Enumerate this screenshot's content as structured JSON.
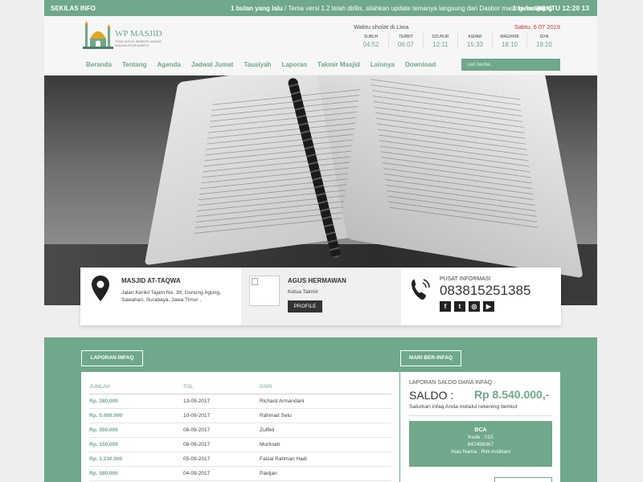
{
  "topbar": {
    "label": "SEKILAS INFO",
    "ticker_ago": "1 bulan yang lalu",
    "ticker_text": " / Tema versi 1.2 telah dirilis, silahkan update temanya langsung dari Dasbor masing-masing",
    "ticker_ago_2": "1 bulan yang",
    "waktu": "WAKTU 12:20 13"
  },
  "logo": {
    "name": "WP MASJID",
    "tagline": "TEMA UNTUK WEBSITE MASJID",
    "tagline2": "DENGAN FITUR KOMPLIT"
  },
  "sholat": {
    "title": "Waktu sholat di Liwa",
    "date": "Sabtu, 6 07 2019",
    "times": [
      {
        "name": "SUBUH",
        "time": "04:52"
      },
      {
        "name": "TERBIT",
        "time": "06:07"
      },
      {
        "name": "DZUHUR",
        "time": "12:11"
      },
      {
        "name": "ASHAR",
        "time": "15:33"
      },
      {
        "name": "MAGHRIB",
        "time": "18:10"
      },
      {
        "name": "ISYA",
        "time": "19:20"
      }
    ]
  },
  "nav": [
    "Beranda",
    "Tentang",
    "Agenda",
    "Jadwal Jumat",
    "Tausiyah",
    "Laporan",
    "Takmir Masjid",
    "Lainnya",
    "Download"
  ],
  "search": {
    "placeholder": "cari berita.."
  },
  "info": {
    "masjid_name": "MASJID AT-TAQWA",
    "masjid_address": "Jalan Kerikil Tajam No. 39, Gunung Agung, Sawahan, Surabaya, Jawa Timur ,",
    "takmir_name": "AGUS HERMAWAN",
    "takmir_role": "Ketua Takmir",
    "profile_btn": "PROFILE",
    "pusat_label": "PUSAT INFORMASI",
    "pusat_phone": "083815251385",
    "socials": [
      "f",
      "t",
      "◎",
      "▶"
    ]
  },
  "laporan": {
    "button": "LAPORAN INFAQ",
    "headers": [
      "JUMLAH",
      "TGL",
      "DARI"
    ],
    "rows": [
      [
        "Rp. 380.000",
        "13-09-2017",
        "Richard Armandani"
      ],
      [
        "Rp. 5.000.000",
        "10-09-2017",
        "Rahmad Seto"
      ],
      [
        "Rp. 350.000",
        "08-09-2017",
        "Zulfikli"
      ],
      [
        "Rp. 150.000",
        "08-09-2017",
        "Murtinah"
      ],
      [
        "Rp. 1.230.000",
        "05-09-2017",
        "Faisal Rahman Hadi"
      ],
      [
        "Rp. 580.000",
        "04-09-2017",
        "Paidjan"
      ]
    ]
  },
  "infaq": {
    "button": "MARI BER-INFAQ",
    "saldo_label": "LAPORAN SALDO DANA INFAQ",
    "saldo_title": "SALDO :",
    "saldo_amount": "Rp 8.540.000,-",
    "note": "Salurkan infaq Anda melalui rekening berikut",
    "bank_name": "BCA",
    "bank_code": "Kode : 015",
    "bank_account": "847499367",
    "bank_holder": "Atas Nama : Rini Andriani"
  },
  "colors": {
    "accent": "#6fa88a",
    "date_red": "#c0392b",
    "dark": "#333333"
  }
}
